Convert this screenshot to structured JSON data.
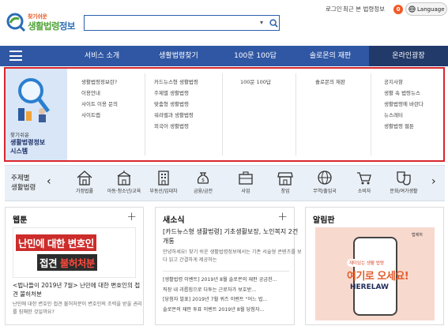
{
  "header": {
    "logo_small": "찾기쉬운",
    "logo_big_a": "생활법령",
    "logo_big_b": "정보",
    "search": {
      "placeholder": ""
    },
    "login": "로그인",
    "recent": "최근 본 법령정보",
    "recent_count": "0",
    "language": "Language"
  },
  "nav": {
    "items": [
      {
        "label": "서비스 소개"
      },
      {
        "label": "생활법령찾기"
      },
      {
        "label": "100문 100답"
      },
      {
        "label": "솔로몬의 재판"
      },
      {
        "label": "온라인광장"
      }
    ]
  },
  "mega": {
    "promo_small": "찾기쉬운",
    "promo_big_1": "생활법령정보",
    "promo_big_2": "시스템",
    "columns": [
      {
        "links": [
          "생활법령정보란?",
          "이용안내",
          "사이트 이용 문의",
          "사이트맵"
        ]
      },
      {
        "links": [
          "카드뉴스형 생활법령",
          "주제별 생활법령",
          "맞춤형 생활법령",
          "워라밸과 생활법령",
          "외국어 생활법령"
        ]
      },
      {
        "links": [
          "100문 100답"
        ]
      },
      {
        "links": [
          "솔로몬의 재판"
        ]
      },
      {
        "links": [
          "공지사항",
          "생활 속 법령뉴스",
          "생활법령에 바란다",
          "뉴스레터",
          "생활법령 웹툰"
        ]
      }
    ]
  },
  "categories": {
    "label_1": "주제별",
    "label_2": "생활법령",
    "items": [
      {
        "label": "가정법률",
        "icon": "house-icon"
      },
      {
        "label": "아동·청소년/교육",
        "icon": "school-icon"
      },
      {
        "label": "부동산/임대차",
        "icon": "building-icon"
      },
      {
        "label": "금융/금전",
        "icon": "money-bag-icon"
      },
      {
        "label": "사업",
        "icon": "briefcase-icon"
      },
      {
        "label": "창업",
        "icon": "store-icon"
      },
      {
        "label": "무역/출입국",
        "icon": "globe-icon"
      },
      {
        "label": "소비자",
        "icon": "cart-icon"
      },
      {
        "label": "문화/여가생활",
        "icon": "theater-icon"
      }
    ]
  },
  "webtoon": {
    "title": "웹툰",
    "img_line1": "난민에 대한 변호인",
    "img_line2a": "접견 ",
    "img_line2b": "불허처분",
    "headline": "<법나들이 2019년 7월> 난민에 대한 변호인의 접견 불허처분",
    "desc": "난민에 대한 변호인 접견 불허처분이 변호인의 조력을 받을 권리를 침해한 것일까요?"
  },
  "news": {
    "title": "새소식",
    "headline": "[카드뉴스형 생활법령] 기초생활보장, 노인복지 2건 개통",
    "desc": "안녕하세요! 찾기 쉬운 생활법령정보에서는 기존 서술형 콘텐츠를 보다 읽고 간결하게 제공하는",
    "list": [
      "[생활법령 이벤트] 2019년 8월 솔로몬의 재판 공금한...",
      "직장 내 괴롭힘으로 다투는 근로자가 보호받...",
      "[당첨자 발표] 2019년 7월 퀴즈 이벤트 \"어느 법...",
      "솔로몬의 재판 투표 이벤트 2019년 8월 당첨자..."
    ]
  },
  "notice": {
    "title": "알림판",
    "img_tag": "재미있는 생활 법령",
    "img_big": "여기로 오세요!",
    "img_en": "HERELAW",
    "img_seal": "법제처"
  },
  "colors": {
    "nav_bg": "#2f57a4",
    "nav_active": "#223a6a",
    "highlight_border": "#d9262e",
    "badge": "#f05a28"
  }
}
